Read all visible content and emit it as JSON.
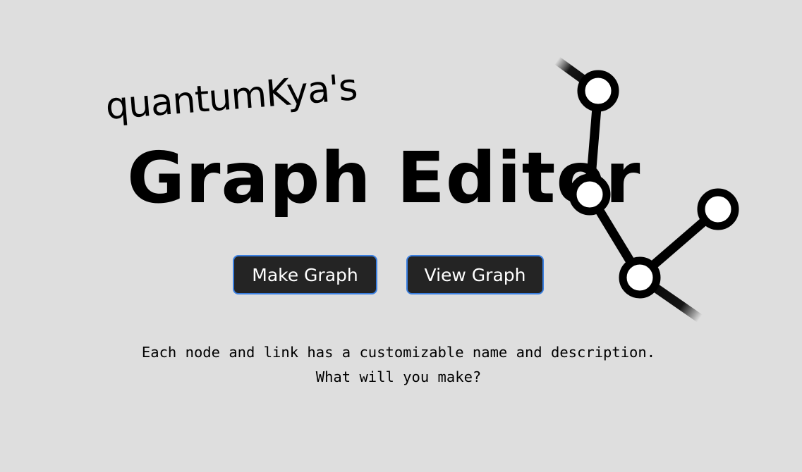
{
  "logo": {
    "subtitle": "quantumKya's",
    "title": "Graph Editor"
  },
  "buttons": {
    "make_graph": "Make Graph",
    "view_graph": "View Graph"
  },
  "description": {
    "line1": "Each node and link has a customizable name and description.",
    "line2": "What will you make?"
  },
  "colors": {
    "background": "#dedede",
    "button_bg": "#242424",
    "button_border": "#3a7fe0",
    "button_text": "#ffffff",
    "ink": "#000000"
  }
}
